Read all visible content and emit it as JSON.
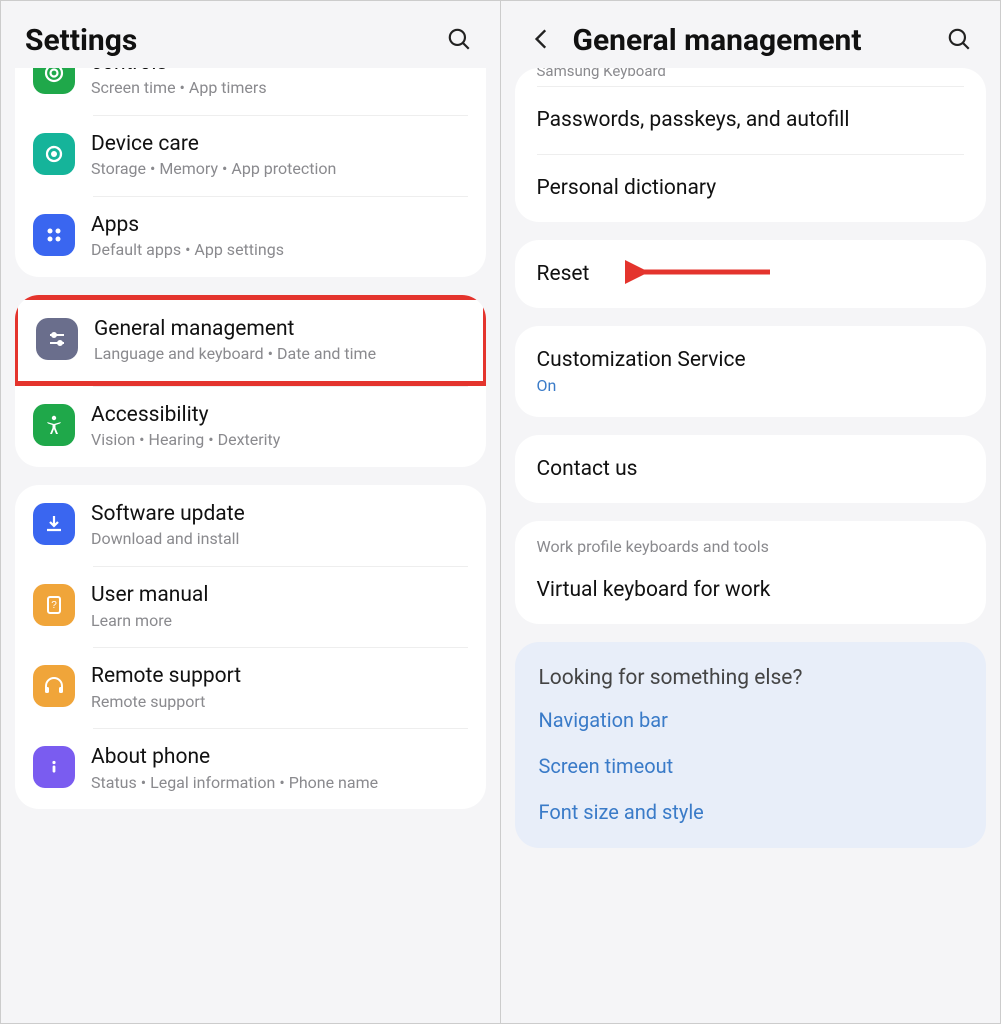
{
  "left": {
    "title": "Settings",
    "groups": [
      {
        "items": [
          {
            "title": "controls",
            "sub": "Screen time  •  App timers",
            "icon": "wellbeing",
            "color": "#1fa84a",
            "truncated_top": true
          },
          {
            "title": "Device care",
            "sub": "Storage  •  Memory  •  App protection",
            "icon": "device-care",
            "color": "#15b49a"
          },
          {
            "title": "Apps",
            "sub": "Default apps  •  App settings",
            "icon": "apps",
            "color": "#3a66f0"
          }
        ]
      },
      {
        "items": [
          {
            "title": "General management",
            "sub": "Language and keyboard  •  Date and time",
            "icon": "sliders",
            "color": "#6a6e8c",
            "highlight": true
          },
          {
            "title": "Accessibility",
            "sub": "Vision  •  Hearing  •  Dexterity",
            "icon": "accessibility",
            "color": "#1fa84a"
          }
        ]
      },
      {
        "items": [
          {
            "title": "Software update",
            "sub": "Download and install",
            "icon": "update",
            "color": "#3a66f0"
          },
          {
            "title": "User manual",
            "sub": "Learn more",
            "icon": "manual",
            "color": "#f0a53a"
          },
          {
            "title": "Remote support",
            "sub": "Remote support",
            "icon": "headset",
            "color": "#f0a53a"
          },
          {
            "title": "About phone",
            "sub": "Status  •  Legal information  •  Phone name",
            "icon": "info",
            "color": "#7a5cf0"
          }
        ]
      }
    ]
  },
  "right": {
    "title": "General management",
    "top_truncated_sub": "Samsung Keyboard",
    "group1": [
      {
        "title": "Passwords, passkeys, and autofill"
      },
      {
        "title": "Personal dictionary"
      }
    ],
    "reset": {
      "title": "Reset",
      "arrow": true
    },
    "customization": {
      "title": "Customization Service",
      "status": "On"
    },
    "contact": {
      "title": "Contact us"
    },
    "work_section_label": "Work profile keyboards and tools",
    "work_item": {
      "title": "Virtual keyboard for work"
    },
    "suggest": {
      "heading": "Looking for something else?",
      "links": [
        "Navigation bar",
        "Screen timeout",
        "Font size and style"
      ]
    }
  }
}
